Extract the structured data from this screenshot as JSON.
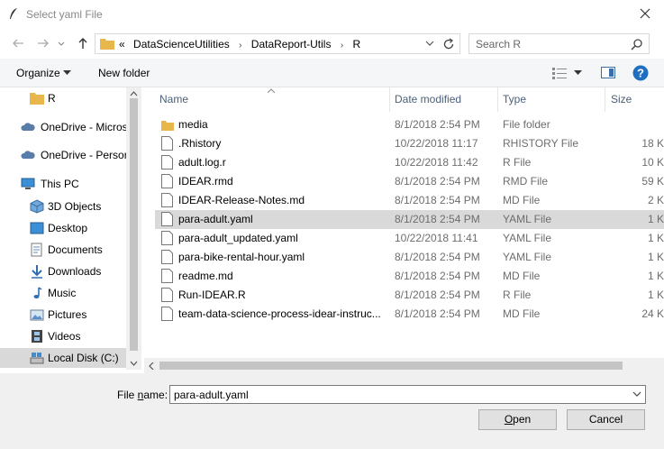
{
  "window": {
    "title": "Select yaml File"
  },
  "address": {
    "overflow_marker": "«",
    "crumbs": [
      "DataScienceUtilities",
      "DataReport-Utils",
      "R"
    ]
  },
  "search": {
    "placeholder": "Search R"
  },
  "toolbar": {
    "organize_label": "Organize",
    "new_folder_label": "New folder"
  },
  "nav": {
    "items": [
      {
        "label": "R",
        "icon": "folder-icon"
      },
      {
        "label": "OneDrive - Micros",
        "icon": "cloud-icon"
      },
      {
        "label": "OneDrive - Persor",
        "icon": "cloud-icon"
      },
      {
        "label": "This PC",
        "icon": "computer-icon"
      },
      {
        "label": "3D Objects",
        "icon": "cube-icon"
      },
      {
        "label": "Desktop",
        "icon": "desktop-icon"
      },
      {
        "label": "Documents",
        "icon": "documents-icon"
      },
      {
        "label": "Downloads",
        "icon": "download-arrow-icon"
      },
      {
        "label": "Music",
        "icon": "music-note-icon"
      },
      {
        "label": "Pictures",
        "icon": "pictures-icon"
      },
      {
        "label": "Videos",
        "icon": "film-icon"
      },
      {
        "label": "Local Disk (C:)",
        "icon": "disk-icon",
        "selected": true
      }
    ]
  },
  "columns": {
    "name": "Name",
    "date": "Date modified",
    "type": "Type",
    "size": "Size"
  },
  "files": [
    {
      "name": "media",
      "date": "8/1/2018 2:54 PM",
      "type": "File folder",
      "size": "",
      "icon": "folder-icon"
    },
    {
      "name": ".Rhistory",
      "date": "10/22/2018 11:17",
      "type": "RHISTORY File",
      "size": "18 K",
      "icon": "file-icon"
    },
    {
      "name": "adult.log.r",
      "date": "10/22/2018 11:42",
      "type": "R File",
      "size": "10 K",
      "icon": "file-icon"
    },
    {
      "name": "IDEAR.rmd",
      "date": "8/1/2018 2:54 PM",
      "type": "RMD File",
      "size": "59 K",
      "icon": "file-icon"
    },
    {
      "name": "IDEAR-Release-Notes.md",
      "date": "8/1/2018 2:54 PM",
      "type": "MD File",
      "size": "2 K",
      "icon": "file-icon"
    },
    {
      "name": "para-adult.yaml",
      "date": "8/1/2018 2:54 PM",
      "type": "YAML File",
      "size": "1 K",
      "icon": "file-icon",
      "selected": true
    },
    {
      "name": "para-adult_updated.yaml",
      "date": "10/22/2018 11:41",
      "type": "YAML File",
      "size": "1 K",
      "icon": "file-icon"
    },
    {
      "name": "para-bike-rental-hour.yaml",
      "date": "8/1/2018 2:54 PM",
      "type": "YAML File",
      "size": "1 K",
      "icon": "file-icon"
    },
    {
      "name": "readme.md",
      "date": "8/1/2018 2:54 PM",
      "type": "MD File",
      "size": "1 K",
      "icon": "file-icon"
    },
    {
      "name": "Run-IDEAR.R",
      "date": "8/1/2018 2:54 PM",
      "type": "R File",
      "size": "1 K",
      "icon": "file-icon"
    },
    {
      "name": "team-data-science-process-idear-instruc...",
      "date": "8/1/2018 2:54 PM",
      "type": "MD File",
      "size": "24 K",
      "icon": "file-icon"
    }
  ],
  "filename": {
    "label_prefix": "File ",
    "label_underlined": "n",
    "label_suffix": "ame:",
    "value": "para-adult.yaml"
  },
  "buttons": {
    "open_underlined": "O",
    "open_rest": "pen",
    "cancel": "Cancel"
  },
  "colors": {
    "folder": "#e8b74c",
    "selection": "#d9d9d9",
    "header_text": "#4c607a",
    "help": "#1e6fbf"
  }
}
